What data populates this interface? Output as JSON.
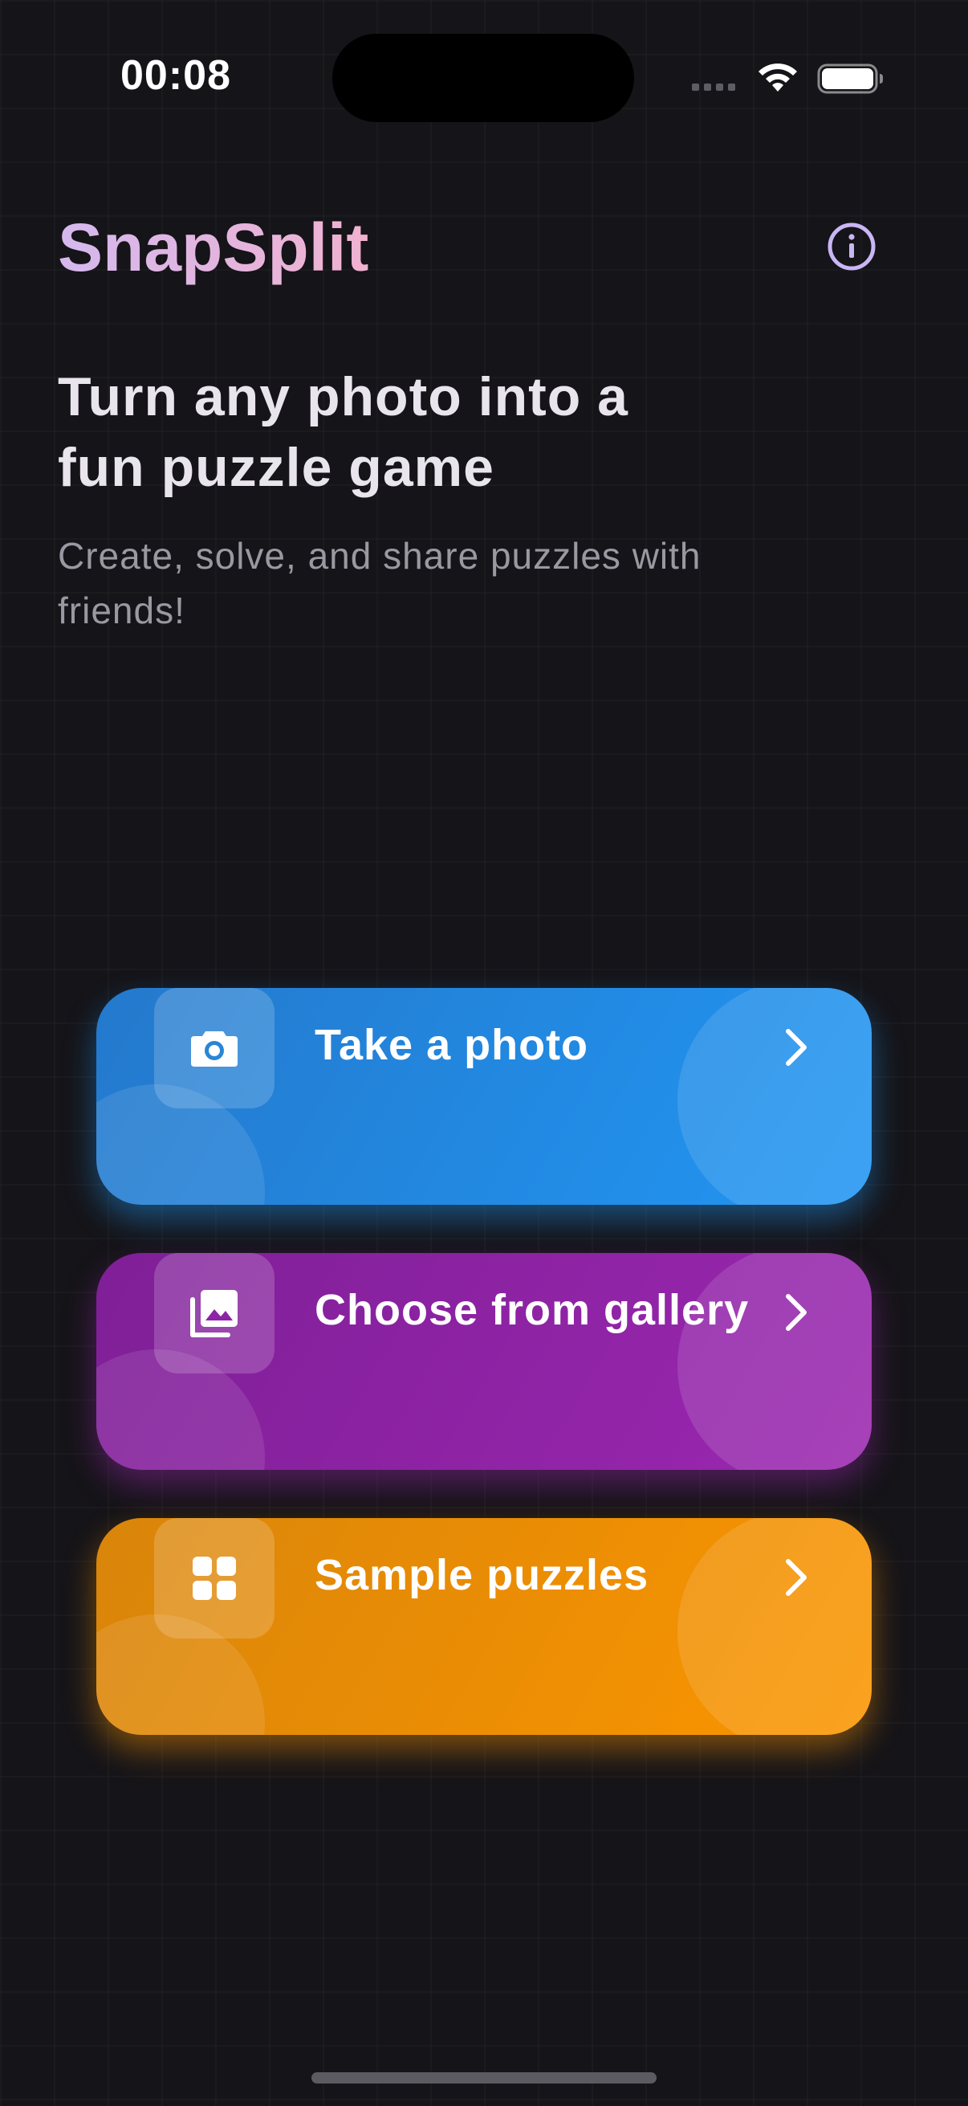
{
  "status_bar": {
    "time": "00:08"
  },
  "header": {
    "app_title": "SnapSplit",
    "info_icon": "info-circle-icon"
  },
  "hero": {
    "headline_line1": "Turn any photo into a",
    "headline_line2": "fun puzzle game",
    "subheadline": "Create, solve, and share puzzles with friends!"
  },
  "actions": [
    {
      "label": "Take a photo",
      "icon": "camera-icon",
      "color": "#2196F3"
    },
    {
      "label": "Choose from gallery",
      "icon": "gallery-icon",
      "color": "#9C27B0"
    },
    {
      "label": "Sample puzzles",
      "icon": "grid-icon",
      "color": "#FB9500"
    }
  ],
  "colors": {
    "background": "#151418",
    "title_gradient_start": "#D4B8EE",
    "title_gradient_end": "#F0B2D0",
    "info_icon": "#C9B6F5"
  }
}
